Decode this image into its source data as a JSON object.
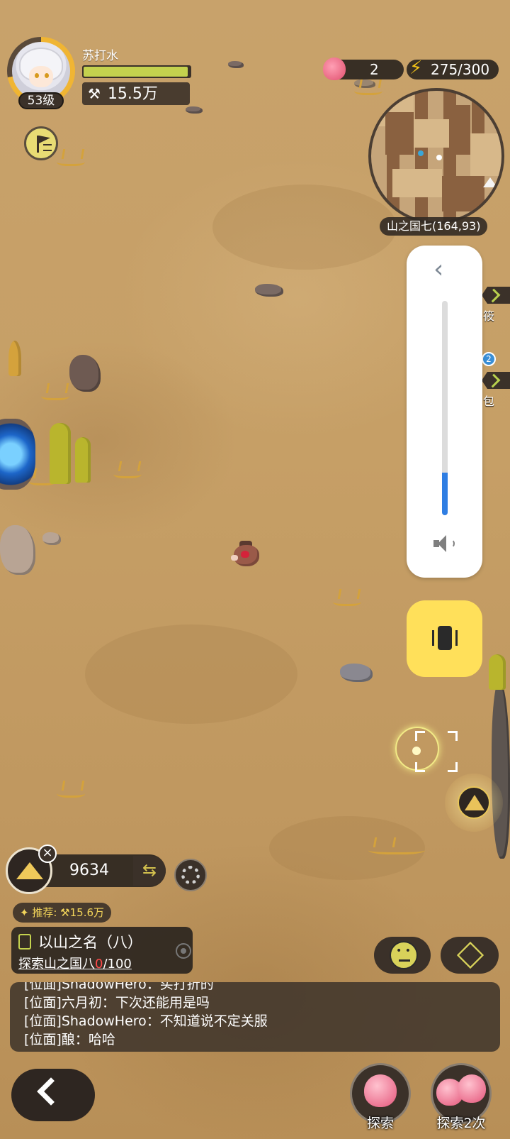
{
  "player": {
    "name": "苏打水",
    "level": "53级",
    "power_value": "15.5万",
    "hp_fraction": 0.98
  },
  "resources": {
    "peach_count": "2",
    "energy": "275/300"
  },
  "minimap": {
    "location": "山之国七(164,93)"
  },
  "volume_panel": {
    "level_fraction": 0.2
  },
  "side_tabs": {
    "notification_count": "2",
    "tab1_fragment": "筱",
    "tab2_fragment": "包"
  },
  "sand": {
    "value": "9634",
    "swap_icon": "swap-icon",
    "close_label": "×"
  },
  "recommend": {
    "label": "推荐:",
    "value": "15.6万"
  },
  "quest": {
    "title": "以山之名（八）",
    "desc_prefix": "探索山之国八",
    "progress_current": "0",
    "progress_total": "/100"
  },
  "chat": {
    "lines": [
      "[位面]ShadowHero：买打折的",
      "[位面]六月初：下次还能用是吗",
      "[位面]ShadowHero：不知道说不定关服",
      "[位面]酿：哈哈"
    ]
  },
  "actions": {
    "explore_label": "探索",
    "explore2_label": "探索2次"
  },
  "colors": {
    "accent_yellow": "#ffe05a",
    "volume_blue": "#2f7ee3",
    "progress_red": "#ff4b4b"
  }
}
